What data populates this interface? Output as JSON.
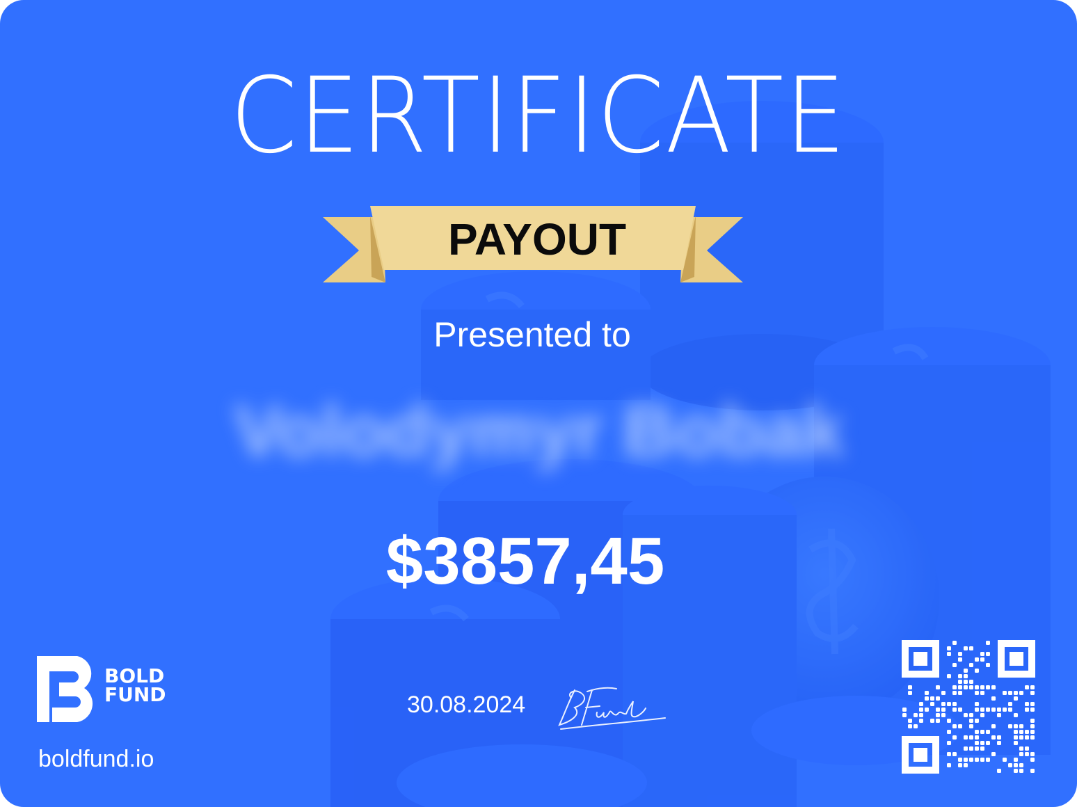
{
  "certificate": {
    "title": "CERTIFICATE",
    "badge": "PAYOUT",
    "presented_label": "Presented to",
    "recipient_name": "Volodymyr Bobak",
    "amount": "$3857,45",
    "date": "30.08.2024",
    "signature": "BFund"
  },
  "brand": {
    "line1": "BOLD",
    "line2": "FUND",
    "website": "boldfund.io"
  },
  "colors": {
    "background": "#3170ff",
    "ribbon_gold": "#f0d898",
    "ribbon_shadow": "#d6b56a",
    "text": "#ffffff"
  }
}
